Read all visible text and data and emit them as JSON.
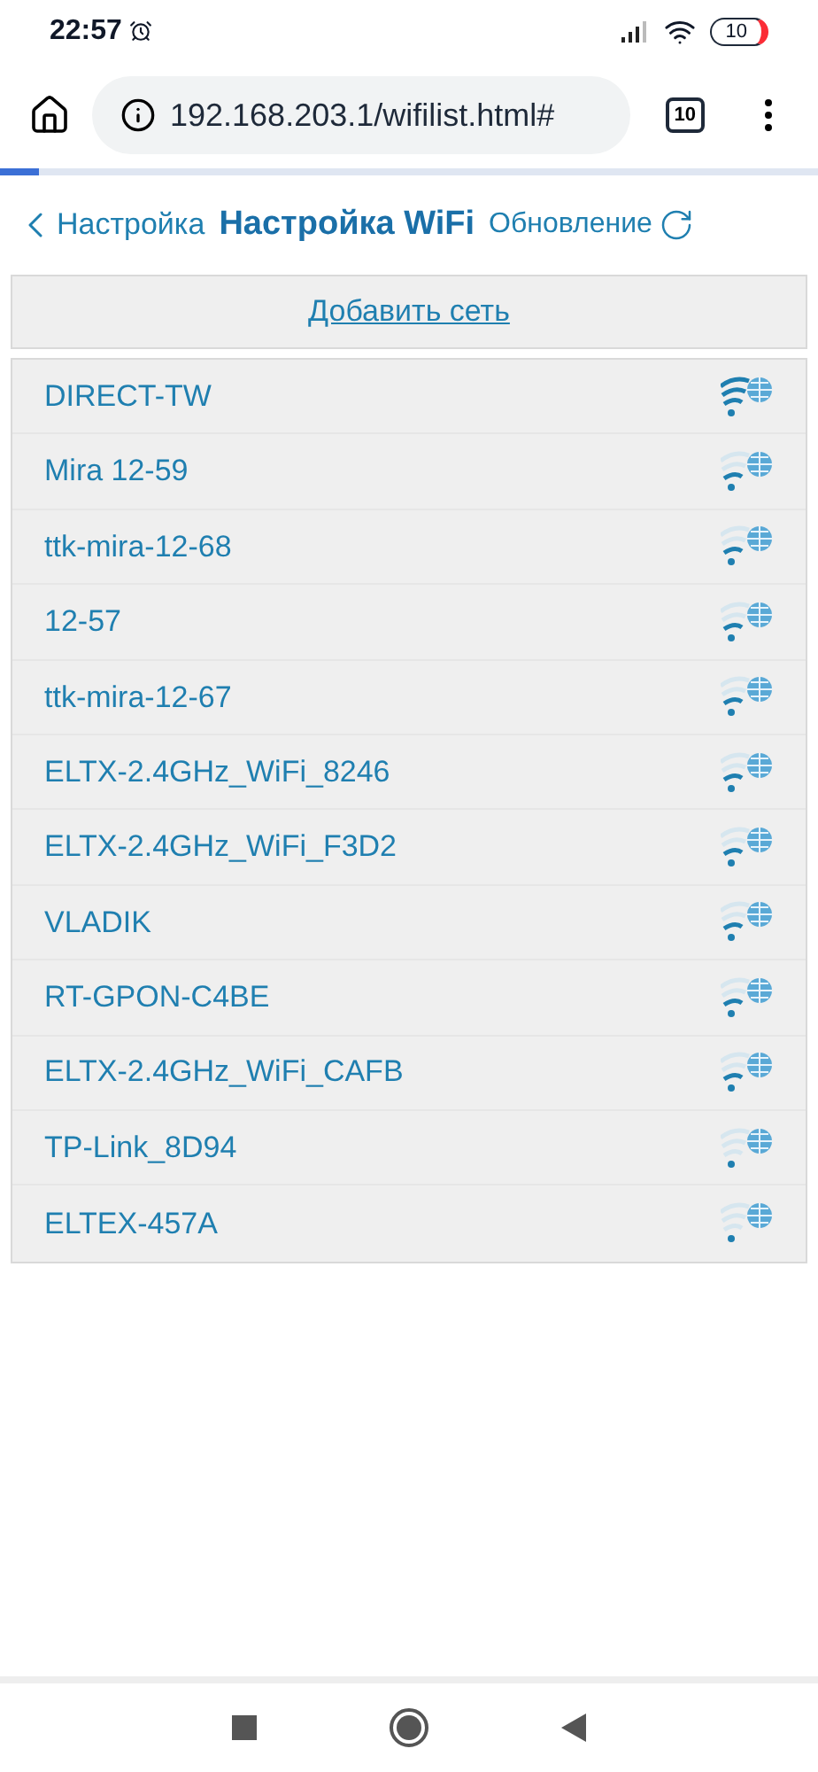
{
  "status_bar": {
    "time": "22:57",
    "battery": "10"
  },
  "browser": {
    "url": "192.168.203.1/wifilist.html#",
    "tab_count": "10"
  },
  "header": {
    "back_label": "Настройка",
    "title": "Настройка WiFi",
    "refresh_label": "Обновление"
  },
  "add_network": "Добавить сеть",
  "networks": [
    {
      "name": "DIRECT-TW",
      "kind": "strong"
    },
    {
      "name": "Mira 12-59",
      "kind": "medium"
    },
    {
      "name": "ttk-mira-12-68",
      "kind": "medium"
    },
    {
      "name": "12-57",
      "kind": "medium"
    },
    {
      "name": "ttk-mira-12-67",
      "kind": "medium"
    },
    {
      "name": "ELTX-2.4GHz_WiFi_8246",
      "kind": "medium"
    },
    {
      "name": "ELTX-2.4GHz_WiFi_F3D2",
      "kind": "medium"
    },
    {
      "name": "VLADIK",
      "kind": "medium"
    },
    {
      "name": "RT-GPON-C4BE",
      "kind": "medium"
    },
    {
      "name": "ELTX-2.4GHz_WiFi_CAFB",
      "kind": "medium"
    },
    {
      "name": "TP-Link_8D94",
      "kind": "weak"
    },
    {
      "name": "ELTEX-457A",
      "kind": "weak"
    }
  ]
}
